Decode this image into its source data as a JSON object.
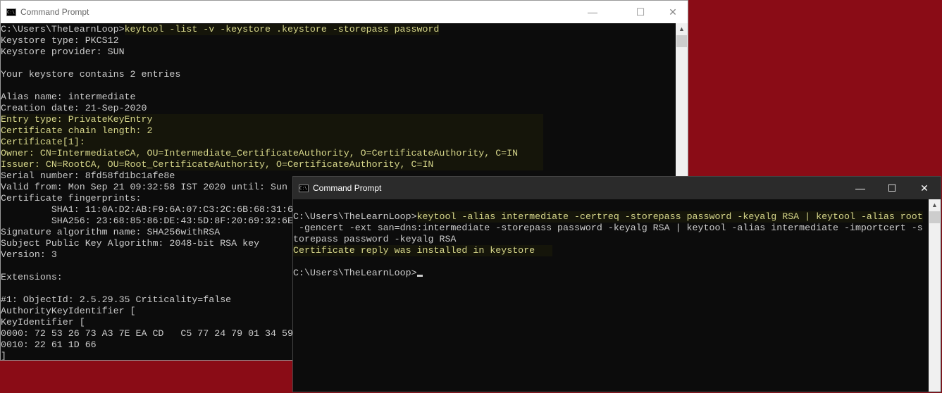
{
  "window1": {
    "title": "Command Prompt",
    "lines": [
      {
        "prompt": "C:\\Users\\TheLearnLoop>",
        "cmd": "keytool -list -v -keystore .keystore -storepass password"
      },
      {
        "text": "Keystore type: PKCS12"
      },
      {
        "text": "Keystore provider: SUN"
      },
      {
        "text": ""
      },
      {
        "text": "Your keystore contains 2 entries"
      },
      {
        "text": ""
      },
      {
        "text": "Alias name: intermediate"
      },
      {
        "text": "Creation date: 21-Sep-2020"
      },
      {
        "hl": "Entry type: PrivateKeyEntry"
      },
      {
        "hl": "Certificate chain length: 2"
      },
      {
        "hl": "Certificate[1]:"
      },
      {
        "hl": "Owner: CN=IntermediateCA, OU=Intermediate_CertificateAuthority, O=CertificateAuthority, C=IN"
      },
      {
        "hl": "Issuer: CN=RootCA, OU=Root_CertificateAuthority, O=CertificateAuthority, C=IN"
      },
      {
        "text": "Serial number: 8fd58fd1bc1afe8e"
      },
      {
        "text": "Valid from: Mon Sep 21 09:32:58 IST 2020 until: Sun"
      },
      {
        "text": "Certificate fingerprints:"
      },
      {
        "text": "         SHA1: 11:0A:D2:AB:F9:6A:07:C3:2C:6B:68:31:6"
      },
      {
        "text": "         SHA256: 23:68:85:86:DE:43:5D:8F:20:69:32:6E"
      },
      {
        "text": "Signature algorithm name: SHA256withRSA"
      },
      {
        "text": "Subject Public Key Algorithm: 2048-bit RSA key"
      },
      {
        "text": "Version: 3"
      },
      {
        "text": ""
      },
      {
        "text": "Extensions:"
      },
      {
        "text": ""
      },
      {
        "text": "#1: ObjectId: 2.5.29.35 Criticality=false"
      },
      {
        "text": "AuthorityKeyIdentifier ["
      },
      {
        "text": "KeyIdentifier ["
      },
      {
        "text": "0000: 72 53 26 73 A3 7E EA CD   C5 77 24 79 01 34 59"
      },
      {
        "text": "0010: 22 61 1D 66"
      },
      {
        "text": "]"
      }
    ]
  },
  "window2": {
    "title": "Command Prompt",
    "lines": [
      {
        "text": ""
      },
      {
        "prompt": "C:\\Users\\TheLearnLoop>",
        "cmd": "keytool -alias intermediate -certreq -storepass password -keyalg RSA | keytool -alias root"
      },
      {
        "text": " -gencert -ext san=dns:intermediate -storepass password -keyalg RSA | keytool -alias intermediate -importcert -s"
      },
      {
        "text": "torepass password -keyalg RSA"
      },
      {
        "hl": "Certificate reply was installed in keystore"
      },
      {
        "text": ""
      },
      {
        "prompt": "C:\\Users\\TheLearnLoop>",
        "cursor": true
      }
    ]
  },
  "controls": {
    "minimize": "—",
    "maximize": "☐",
    "close": "✕",
    "scroll_up": "▲"
  },
  "colors": {
    "desktop": "#8a0c16",
    "terminal_bg": "#0c0c0c",
    "terminal_fg": "#cccccc",
    "highlight_fg": "#d6d68a"
  }
}
